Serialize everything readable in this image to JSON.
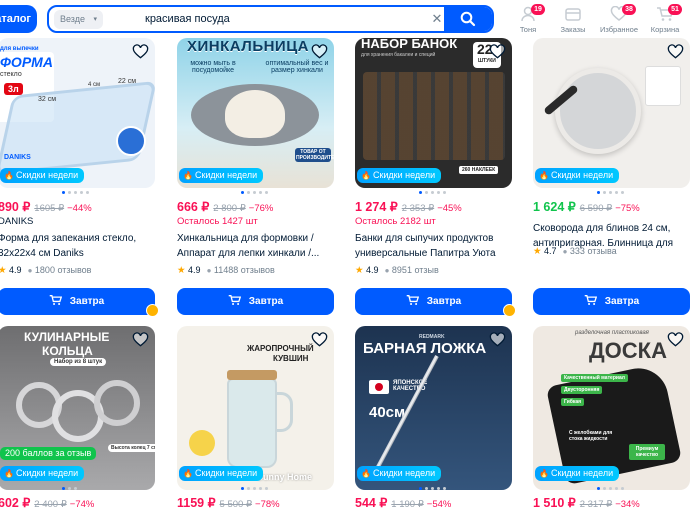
{
  "header": {
    "catalog_label": "Каталог",
    "search_scope": "Везде",
    "search_query": "красивая посуда",
    "nav": [
      {
        "label": "Тоня",
        "badge": "19",
        "icon": "avatar-icon"
      },
      {
        "label": "Заказы",
        "badge": "",
        "icon": "box-icon"
      },
      {
        "label": "Избранное",
        "badge": "38",
        "icon": "heart-icon"
      },
      {
        "label": "Корзина",
        "badge": "51",
        "icon": "cart-icon"
      }
    ],
    "colors": {
      "accent": "#005bff",
      "sale": "#f91155",
      "promo": "#00a2ff",
      "bonus": "#10c44c"
    }
  },
  "products": [
    {
      "image_text": [
        "ФОРМА",
        "для выпечки",
        "стекло",
        "3л",
        "32 см",
        "22 см",
        "4 см",
        "DANIKS"
      ],
      "promo": "Скидки недели",
      "bonus": "",
      "price": "890 ₽",
      "old_price": "1605 ₽",
      "discount": "−44%",
      "brand": "DANIKS",
      "stock": "",
      "title": "Форма для запекания стекло, 32х22х4 см Daniks",
      "rating": "4.9",
      "reviews": "1800 отзывов",
      "button": "Завтра"
    },
    {
      "image_text": [
        "ХИНКАЛЬНИЦА",
        "можно мыть в посудомойке",
        "оптимальный вес и размер хинкали",
        "ТОВАР ОТ ПРОИЗВОДИТЕЛЯ"
      ],
      "promo": "Скидки недели",
      "bonus": "",
      "price": "666 ₽",
      "old_price": "2 800 ₽",
      "discount": "−76%",
      "brand": "",
      "stock": "Осталось 1427 шт",
      "title": "Хинкальница для формовки / Аппарат для лепки хинкали /...",
      "rating": "4.9",
      "reviews": "11488 отзывов",
      "button": "Завтра"
    },
    {
      "image_text": [
        "НАБОР БАНОК",
        "для хранения бакалеи и специй",
        "22",
        "ШТУКИ",
        "260 НАКЛЕЕК"
      ],
      "promo": "Скидки недели",
      "bonus": "",
      "price": "1 274 ₽",
      "old_price": "2 353 ₽",
      "discount": "−45%",
      "brand": "",
      "stock": "Осталось 2182 шт",
      "title": "Банки для сыпучих продуктов универсальные Папитра Уюта 22...",
      "rating": "4.9",
      "reviews": "8951 отзыв",
      "button": "Завтра"
    },
    {
      "image_text": [],
      "promo": "Скидки недели",
      "bonus": "",
      "price": "1 624 ₽",
      "old_price": "6 590 ₽",
      "discount": "−75%",
      "brand": "",
      "stock": "",
      "title": "Сковорода для блинов 24 см, антипригарная. Блинница для все...",
      "rating": "4.7",
      "reviews": "333 отзыва",
      "button": "Завтра"
    },
    {
      "image_text": [
        "КУЛИНАРНЫЕ",
        "КОЛЬЦА",
        "Набор из 8 штук",
        "Высота колец 7 см"
      ],
      "promo": "Скидки недели",
      "bonus": "200 баллов за отзыв",
      "price": "602 ₽",
      "old_price": "2 400 ₽",
      "discount": "−74%",
      "brand": "",
      "stock": "",
      "title": "",
      "rating": "",
      "reviews": "",
      "button": ""
    },
    {
      "image_text": [
        "ЖАРОПРОЧНЫЙ",
        "КУВШИН",
        "Sunny Home"
      ],
      "promo": "Скидки недели",
      "bonus": "",
      "price": "1159 ₽",
      "old_price": "5 500 ₽",
      "discount": "−78%",
      "brand": "",
      "stock": "",
      "title": "",
      "rating": "",
      "reviews": "",
      "button": ""
    },
    {
      "image_text": [
        "БАРНАЯ ЛОЖКА",
        "ЯПОНСКОЕ КАЧЕСТВО",
        "40см",
        "REDMARK"
      ],
      "promo": "Скидки недели",
      "bonus": "",
      "price": "544 ₽",
      "old_price": "1 190 ₽",
      "discount": "−54%",
      "brand": "",
      "stock": "",
      "title": "",
      "rating": "",
      "reviews": "",
      "button": ""
    },
    {
      "image_text": [
        "разделочная пластиковая",
        "ДОСКА",
        "Качественный материал",
        "Двусторонняя",
        "Гибкая",
        "С желобками для стока жидкости",
        "Премиум качество"
      ],
      "promo": "Скидки недели",
      "bonus": "",
      "price": "1 510 ₽",
      "old_price": "2 317 ₽",
      "discount": "−34%",
      "brand": "",
      "stock": "",
      "title": "",
      "rating": "",
      "reviews": "",
      "button": ""
    }
  ]
}
